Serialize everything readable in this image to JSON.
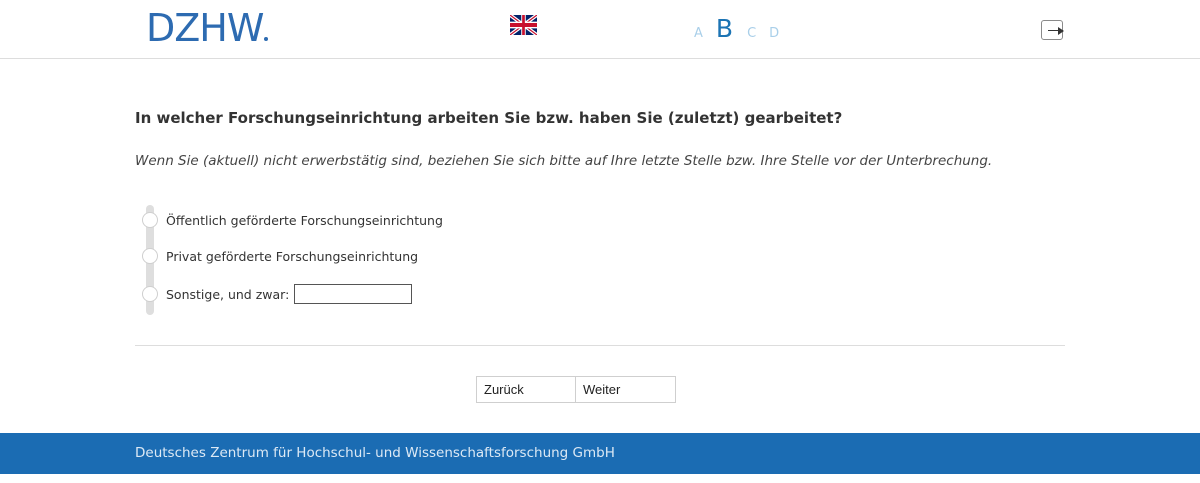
{
  "header": {
    "logo_text": "DZHW",
    "flag_icon": "uk-flag-icon",
    "steps": [
      "A",
      "B",
      "C",
      "D"
    ],
    "active_step": "B",
    "exit_icon": "exit-icon"
  },
  "question": {
    "title": "In welcher Forschungseinrichtung arbeiten Sie bzw. haben Sie (zuletzt) gearbeitet?",
    "instruction": "Wenn Sie (aktuell) nicht erwerbstätig sind, beziehen Sie sich bitte auf Ihre letzte Stelle bzw. Ihre Stelle vor der Unterbrechung."
  },
  "options": [
    {
      "label": "Öffentlich geförderte Forschungseinrichtung"
    },
    {
      "label": "Privat geförderte Forschungseinrichtung"
    },
    {
      "label": "Sonstige, und zwar:",
      "input_value": ""
    }
  ],
  "nav": {
    "back_label": "Zurück",
    "next_label": "Weiter"
  },
  "footer": {
    "text": "Deutsches Zentrum für Hochschul- und Wissenschaftsforschung GmbH"
  },
  "colors": {
    "brand_blue": "#1b6cb3",
    "step_inactive": "#a9cfe9",
    "step_active": "#1c74b4"
  }
}
